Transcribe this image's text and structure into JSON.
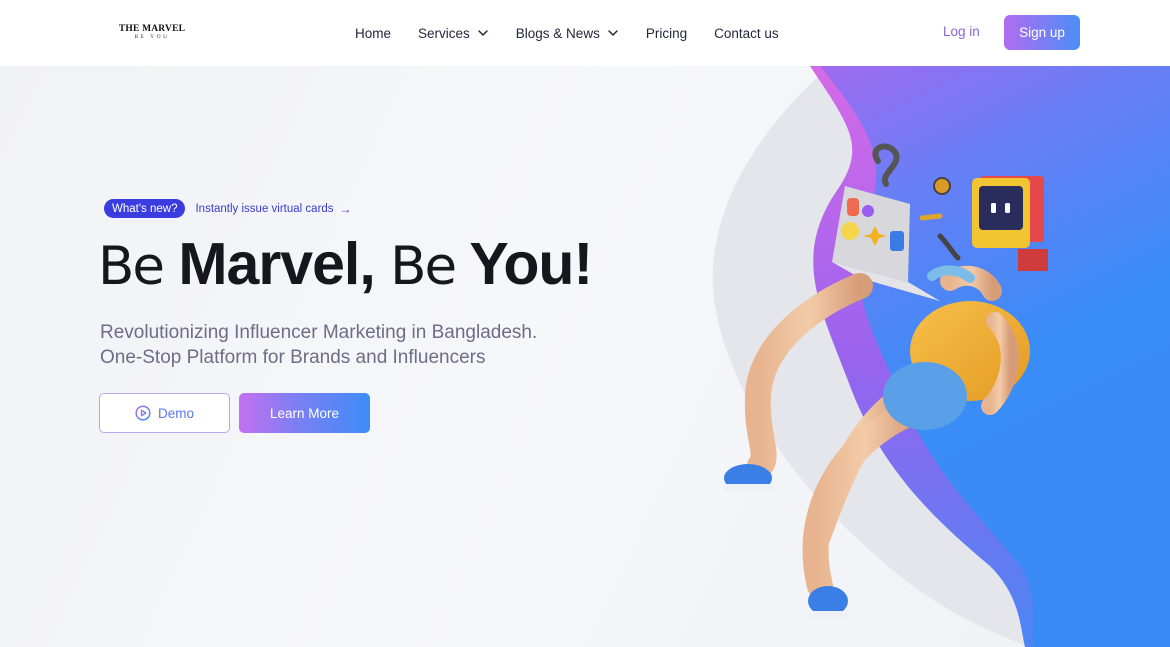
{
  "brand": {
    "logo_main": "THE MARVEL",
    "logo_sub": "BE YOU"
  },
  "nav": {
    "items": [
      {
        "label": "Home",
        "dropdown": false
      },
      {
        "label": "Services",
        "dropdown": true
      },
      {
        "label": "Blogs & News",
        "dropdown": true
      },
      {
        "label": "Pricing",
        "dropdown": false
      },
      {
        "label": "Contact us",
        "dropdown": false
      }
    ],
    "login_label": "Log in",
    "signup_label": "Sign up"
  },
  "announcement": {
    "badge": "What's new?",
    "link_text": "Instantly issue virtual cards",
    "arrow": "→"
  },
  "hero": {
    "title_part1": "Be",
    "title_part2": "Marvel,",
    "title_part3": "Be",
    "title_part4": "You!",
    "subtitle_line1": "Revolutionizing Influencer Marketing in Bangladesh.",
    "subtitle_line2": "One-Stop Platform for Brands and Influencers",
    "demo_label": "Demo",
    "learn_more_label": "Learn More"
  },
  "colors": {
    "accent_purple": "#b06df0",
    "accent_blue": "#3d8cf6",
    "badge_blue": "#3b3ce0"
  },
  "illustration": {
    "icon": "cartoon-character-with-laptop-illustration"
  }
}
